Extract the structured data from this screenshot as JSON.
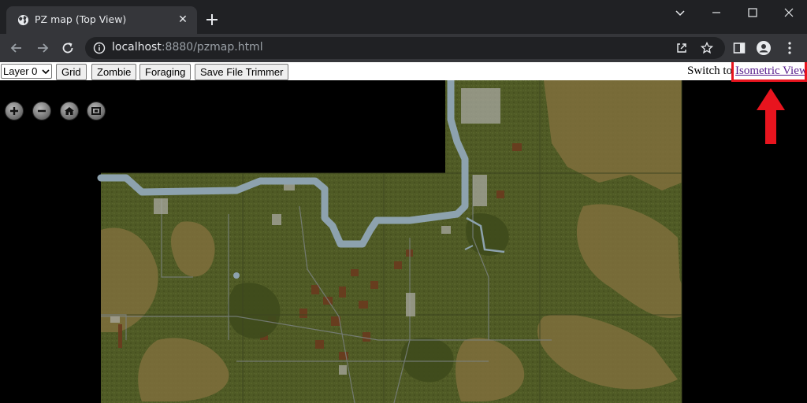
{
  "browser": {
    "tab_title": "PZ map (Top View)",
    "url_host": "localhost",
    "url_rest": ":8880/pzmap.html",
    "icons": {
      "favicon": "globe-icon",
      "tab_close": "close-icon",
      "new_tab": "plus-icon",
      "back": "arrow-left-icon",
      "forward": "arrow-right-icon",
      "reload": "reload-icon",
      "site_info": "info-icon",
      "share": "share-icon",
      "bookmark": "star-icon",
      "side_panel": "side-panel-icon",
      "profile": "profile-icon",
      "menu": "kebab-menu-icon",
      "tab_search": "chevron-down-icon",
      "minimize": "minimize-icon",
      "maximize": "maximize-icon",
      "close_window": "close-icon"
    }
  },
  "page": {
    "layer_select": {
      "value": "Layer 0"
    },
    "buttons": {
      "grid": "Grid",
      "zombie": "Zombie",
      "foraging": "Foraging",
      "save_file_trimmer": "Save File Trimmer"
    },
    "switch_text": "Switch to",
    "switch_link": "Isometric View",
    "map_controls": [
      "zoom-in-icon",
      "zoom-out-icon",
      "home-icon",
      "fullscreen-icon"
    ]
  },
  "colors": {
    "annotation_red": "#e8141e",
    "link_visited": "#551a8b",
    "terrain_green": "#4f5a25",
    "terrain_sand": "#7f6f3c",
    "river": "#8da2ae"
  }
}
